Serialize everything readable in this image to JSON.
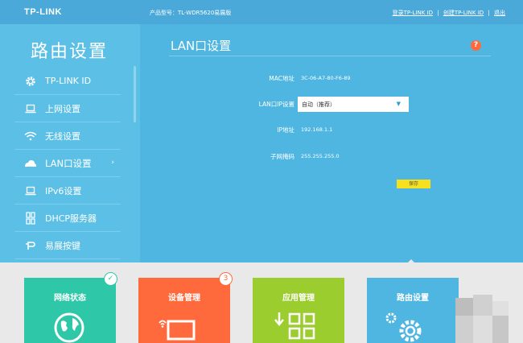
{
  "header": {
    "logo": "TP-LINK",
    "model": "产品型号：TL-WDR5620易展版",
    "login_link": "登录TP-LINK ID",
    "create_link": "创建TP-LINK ID",
    "separator": "|",
    "logout_link": "退出"
  },
  "sidebar": {
    "title": "路由设置",
    "items": [
      {
        "label": "TP-LINK ID",
        "icon": "gear-icon"
      },
      {
        "label": "上网设置",
        "icon": "laptop-icon"
      },
      {
        "label": "无线设置",
        "icon": "wifi-icon"
      },
      {
        "label": "LAN口设置",
        "icon": "cloud-icon",
        "arrow": "›"
      },
      {
        "label": "IPv6设置",
        "icon": "laptop-icon"
      },
      {
        "label": "DHCP服务器",
        "icon": "dhcp-icon"
      },
      {
        "label": "易展按键",
        "icon": "easymesh-icon"
      }
    ]
  },
  "main": {
    "title": "LAN口设置",
    "help": "?",
    "mac_label": "MAC地址",
    "mac_value": "3C-06-A7-80-F6-89",
    "lanip_label": "LAN口IP设置",
    "lanip_value": "自动（推荐）",
    "lanip_caret": "▼",
    "ip_label": "IP地址",
    "ip_value": "192.168.1.1",
    "mask_label": "子网掩码",
    "mask_value": "255.255.255.0",
    "save_label": "保存"
  },
  "tiles": [
    {
      "label": "网络状态",
      "color": "#2ec8a8",
      "badge": "✓"
    },
    {
      "label": "设备管理",
      "color": "#ff6a3d",
      "badge": "3"
    },
    {
      "label": "应用管理",
      "color": "#9ccd2e"
    },
    {
      "label": "路由设置",
      "color": "#4fb6e2"
    }
  ],
  "colors": {
    "main_bg": "#4fb6e2",
    "sidebar_bg": "#5cc0e6",
    "save_button": "#f7e11c",
    "help_icon": "#ff6a3d"
  }
}
